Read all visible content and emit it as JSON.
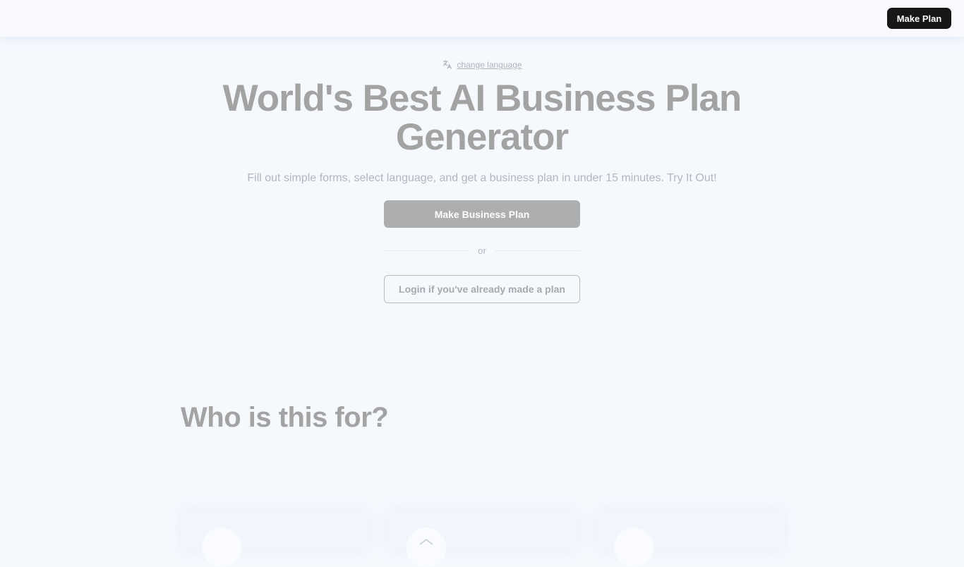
{
  "header": {
    "cta_label": "Make Plan"
  },
  "hero": {
    "language_link": "change language",
    "title_line1": "World's Best AI Business Plan",
    "title_line2": "Generator",
    "subtitle": "Fill out simple forms, select language, and get a business plan in under 15 minutes. Try It Out!",
    "primary_button": "Make Business Plan",
    "divider_text": "or",
    "secondary_button": "Login if you've already made a plan"
  },
  "audience": {
    "title": "Who is this for?"
  },
  "icons": {
    "language": "translate-icon",
    "card_2": "home-icon"
  },
  "colors": {
    "header_button_bg": "#171717",
    "primary_button_bg": "#adaeb0",
    "page_bg": "#f5f9fe"
  }
}
